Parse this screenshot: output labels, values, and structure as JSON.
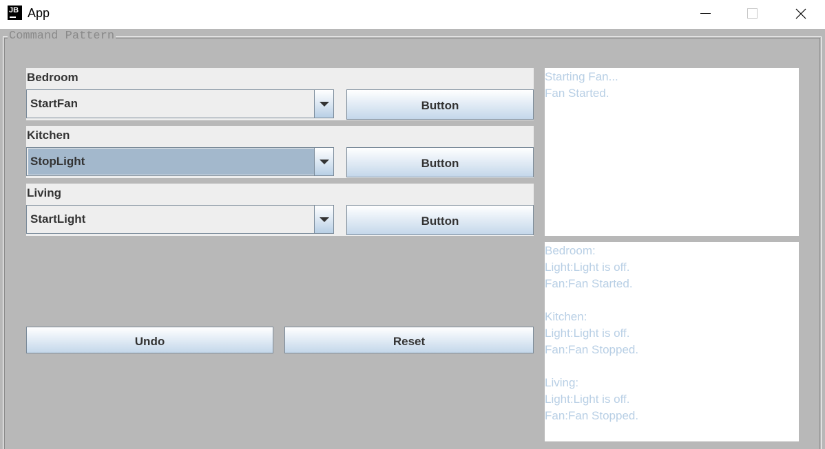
{
  "window": {
    "title": "App",
    "icon_text": "JB"
  },
  "panel": {
    "title": "Command Pattern"
  },
  "rooms": [
    {
      "label": "Bedroom",
      "command": "StartFan",
      "button_label": "Button"
    },
    {
      "label": "Kitchen",
      "command": "StopLight",
      "button_label": "Button"
    },
    {
      "label": "Living",
      "command": "StartLight",
      "button_label": "Button"
    }
  ],
  "actions": {
    "undo_label": "Undo",
    "reset_label": "Reset"
  },
  "log": {
    "lines": [
      "Starting Fan...",
      "Fan Started."
    ]
  },
  "status": {
    "lines": [
      "Bedroom:",
      "Light:Light is off.",
      "Fan:Fan Started.",
      "",
      "Kitchen:",
      "Light:Light is off.",
      "Fan:Fan Stopped.",
      "",
      "Living:",
      "Light:Light is off.",
      "Fan:Fan Stopped."
    ]
  },
  "colors": {
    "panel_bg": "#b8b8b8",
    "section_bg": "#eeeeee",
    "selected_bg": "#a3b8cc",
    "textarea_text": "#b8cfe5"
  }
}
